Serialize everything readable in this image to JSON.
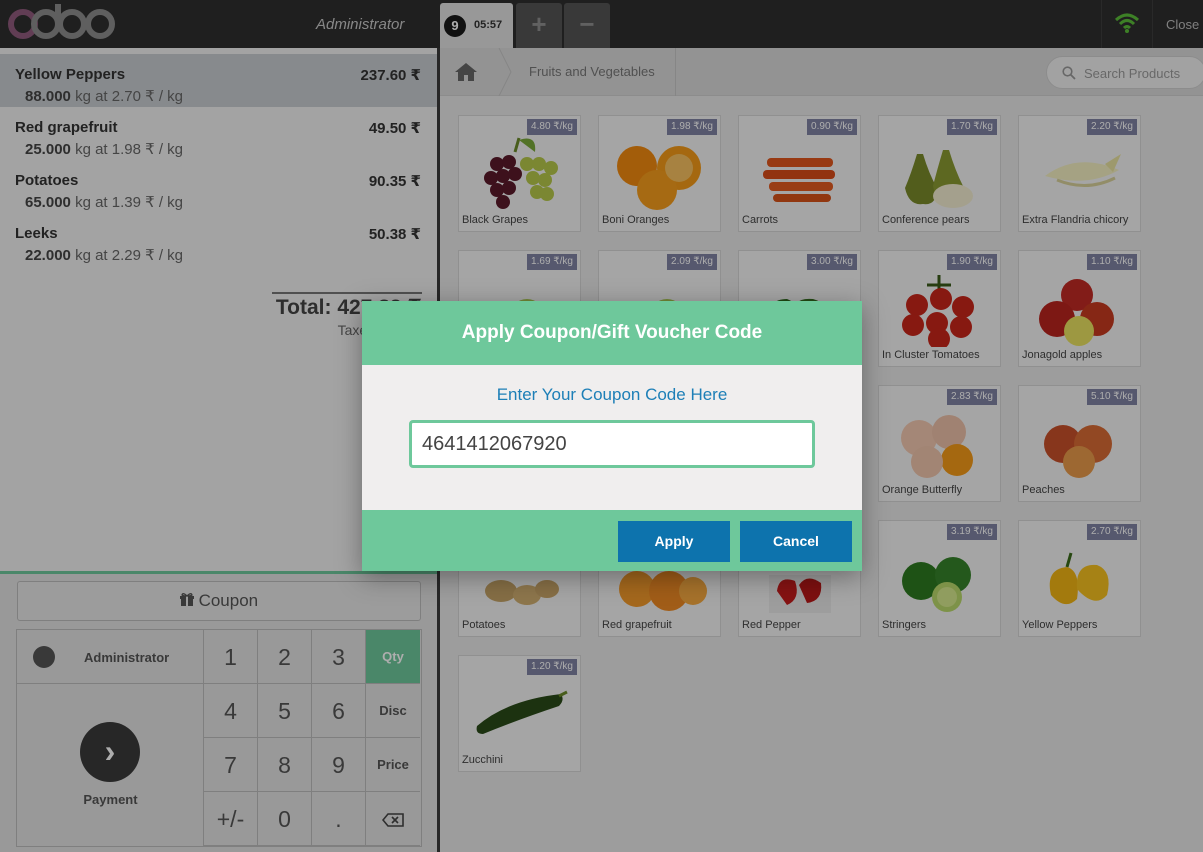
{
  "header": {
    "logo_text": "odoo",
    "cashier": "Administrator",
    "order_number": "9",
    "order_time": "05:57",
    "add_order_symbol": "+",
    "remove_order_symbol": "−",
    "wifi_icon": "wifi-icon",
    "close_label": "Close"
  },
  "order": {
    "lines": [
      {
        "name": "Yellow Peppers",
        "price": "237.60 ₹",
        "qty": "88.000",
        "info": "kg at 2.70 ₹ / kg",
        "selected": true
      },
      {
        "name": "Red grapefruit",
        "price": "49.50 ₹",
        "qty": "25.000",
        "info": "kg at 1.98 ₹ / kg",
        "selected": false
      },
      {
        "name": "Potatoes",
        "price": "90.35 ₹",
        "qty": "65.000",
        "info": "kg at 1.39 ₹ / kg",
        "selected": false
      },
      {
        "name": "Leeks",
        "price": "50.38 ₹",
        "qty": "22.000",
        "info": "kg at 2.29 ₹ / kg",
        "selected": false
      }
    ],
    "total_label": "Total: 427.83 ₹",
    "taxes_label": "Taxes: 0.00 ₹"
  },
  "actions": {
    "coupon_label": "Coupon",
    "coupon_icon": "gift-icon",
    "customer_label": "Administrator",
    "payment_label": "Payment",
    "payment_icon": "chevron-right-icon"
  },
  "numpad": {
    "keys": [
      "1",
      "2",
      "3",
      "4",
      "5",
      "6",
      "7",
      "8",
      "9",
      "+/-",
      "0",
      "."
    ],
    "modes": [
      "Qty",
      "Disc",
      "Price"
    ],
    "active_mode": "Qty",
    "backspace_icon": "backspace-icon"
  },
  "products_bar": {
    "home_icon": "home-icon",
    "category": "Fruits and Vegetables",
    "search_placeholder": "Search Products",
    "search_icon": "search-icon"
  },
  "products": [
    {
      "name": "Black Grapes",
      "price": "4.80 ₹/kg",
      "img": "grapes"
    },
    {
      "name": "Boni Oranges",
      "price": "1.98 ₹/kg",
      "img": "oranges"
    },
    {
      "name": "Carrots",
      "price": "0.90 ₹/kg",
      "img": "carrots"
    },
    {
      "name": "Conference pears",
      "price": "1.70 ₹/kg",
      "img": "pears"
    },
    {
      "name": "Extra Flandria chicory",
      "price": "2.20 ₹/kg",
      "img": "chicory"
    },
    {
      "name": "",
      "price": "1.69 ₹/kg",
      "img": "green-apples"
    },
    {
      "name": "",
      "price": "2.09 ₹/kg",
      "img": "green-apples2"
    },
    {
      "name": "",
      "price": "3.00 ₹/kg",
      "img": "green-peppers"
    },
    {
      "name": "In Cluster Tomatoes",
      "price": "1.90 ₹/kg",
      "img": "tomatoes"
    },
    {
      "name": "Jonagold apples",
      "price": "1.10 ₹/kg",
      "img": "red-apples"
    },
    {
      "name": "",
      "price": "",
      "img": "none"
    },
    {
      "name": "",
      "price": "",
      "img": "none"
    },
    {
      "name": "",
      "price": "",
      "img": "none"
    },
    {
      "name": "Orange Butterfly",
      "price": "2.83 ₹/kg",
      "img": "orange-butterfly"
    },
    {
      "name": "Peaches",
      "price": "5.10 ₹/kg",
      "img": "peaches"
    },
    {
      "name": "Potatoes",
      "price": "",
      "img": "potatoes"
    },
    {
      "name": "Red grapefruit",
      "price": "",
      "img": "grapefruit"
    },
    {
      "name": "Red Pepper",
      "price": "",
      "img": "red-pepper"
    },
    {
      "name": "Stringers",
      "price": "3.19 ₹/kg",
      "img": "limes"
    },
    {
      "name": "Yellow Peppers",
      "price": "2.70 ₹/kg",
      "img": "yellow-peppers"
    },
    {
      "name": "Zucchini",
      "price": "1.20 ₹/kg",
      "img": "zucchini"
    }
  ],
  "dialog": {
    "title": "Apply Coupon/Gift Voucher Code",
    "prompt": "Enter Your Coupon Code Here",
    "code_value": "4641412067920",
    "apply_label": "Apply",
    "cancel_label": "Cancel"
  },
  "colors": {
    "accent_green": "#6ec89b",
    "button_blue": "#0d73ad",
    "header_dark": "#2f2f2f",
    "price_tag": "#7f82a2"
  }
}
